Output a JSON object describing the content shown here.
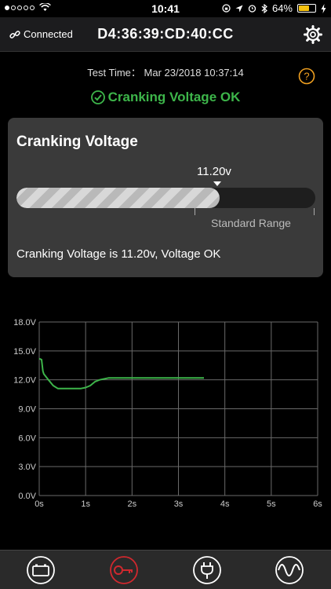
{
  "status_bar": {
    "time": "10:41",
    "battery": "64%",
    "battery_level": 0.64
  },
  "header": {
    "connection": "Connected",
    "device_id": "D4:36:39:CD:40:CC"
  },
  "test": {
    "label": "Test Time：",
    "time": "Mar 23/2018 10:37:14"
  },
  "result": {
    "status": "Cranking Voltage OK",
    "color": "#3db54a"
  },
  "card": {
    "title": "Cranking Voltage",
    "reading": "11.20v",
    "value": 11.2,
    "range_label": "Standard Range",
    "message": "Cranking Voltage is 11.20v, Voltage OK"
  },
  "chart_data": {
    "type": "line",
    "xlabel": "",
    "ylabel": "",
    "xlim": [
      0,
      6
    ],
    "ylim": [
      0,
      18
    ],
    "x_ticks": [
      "0s",
      "1s",
      "2s",
      "3s",
      "4s",
      "5s",
      "6s"
    ],
    "y_ticks": [
      "0.0V",
      "3.0V",
      "6.0V",
      "9.0V",
      "12.0V",
      "15.0V",
      "18.0V"
    ],
    "grid": true,
    "series": [
      {
        "color": "#3db54a",
        "x": [
          0,
          0.05,
          0.08,
          0.1,
          0.2,
          0.3,
          0.4,
          0.7,
          0.9,
          1.0,
          1.1,
          1.2,
          1.3,
          1.5,
          2.0,
          3.0,
          3.55
        ],
        "y": [
          14.2,
          14.1,
          12.9,
          12.6,
          12.0,
          11.4,
          11.1,
          11.1,
          11.1,
          11.2,
          11.4,
          11.8,
          12.0,
          12.2,
          12.2,
          12.2,
          12.2
        ]
      }
    ]
  },
  "tabs": [
    {
      "icon": "battery-icon",
      "active": false
    },
    {
      "icon": "key-icon",
      "active": true,
      "color": "#d0282e"
    },
    {
      "icon": "plug-icon",
      "active": false
    },
    {
      "icon": "sine-wave-icon",
      "active": false
    }
  ]
}
